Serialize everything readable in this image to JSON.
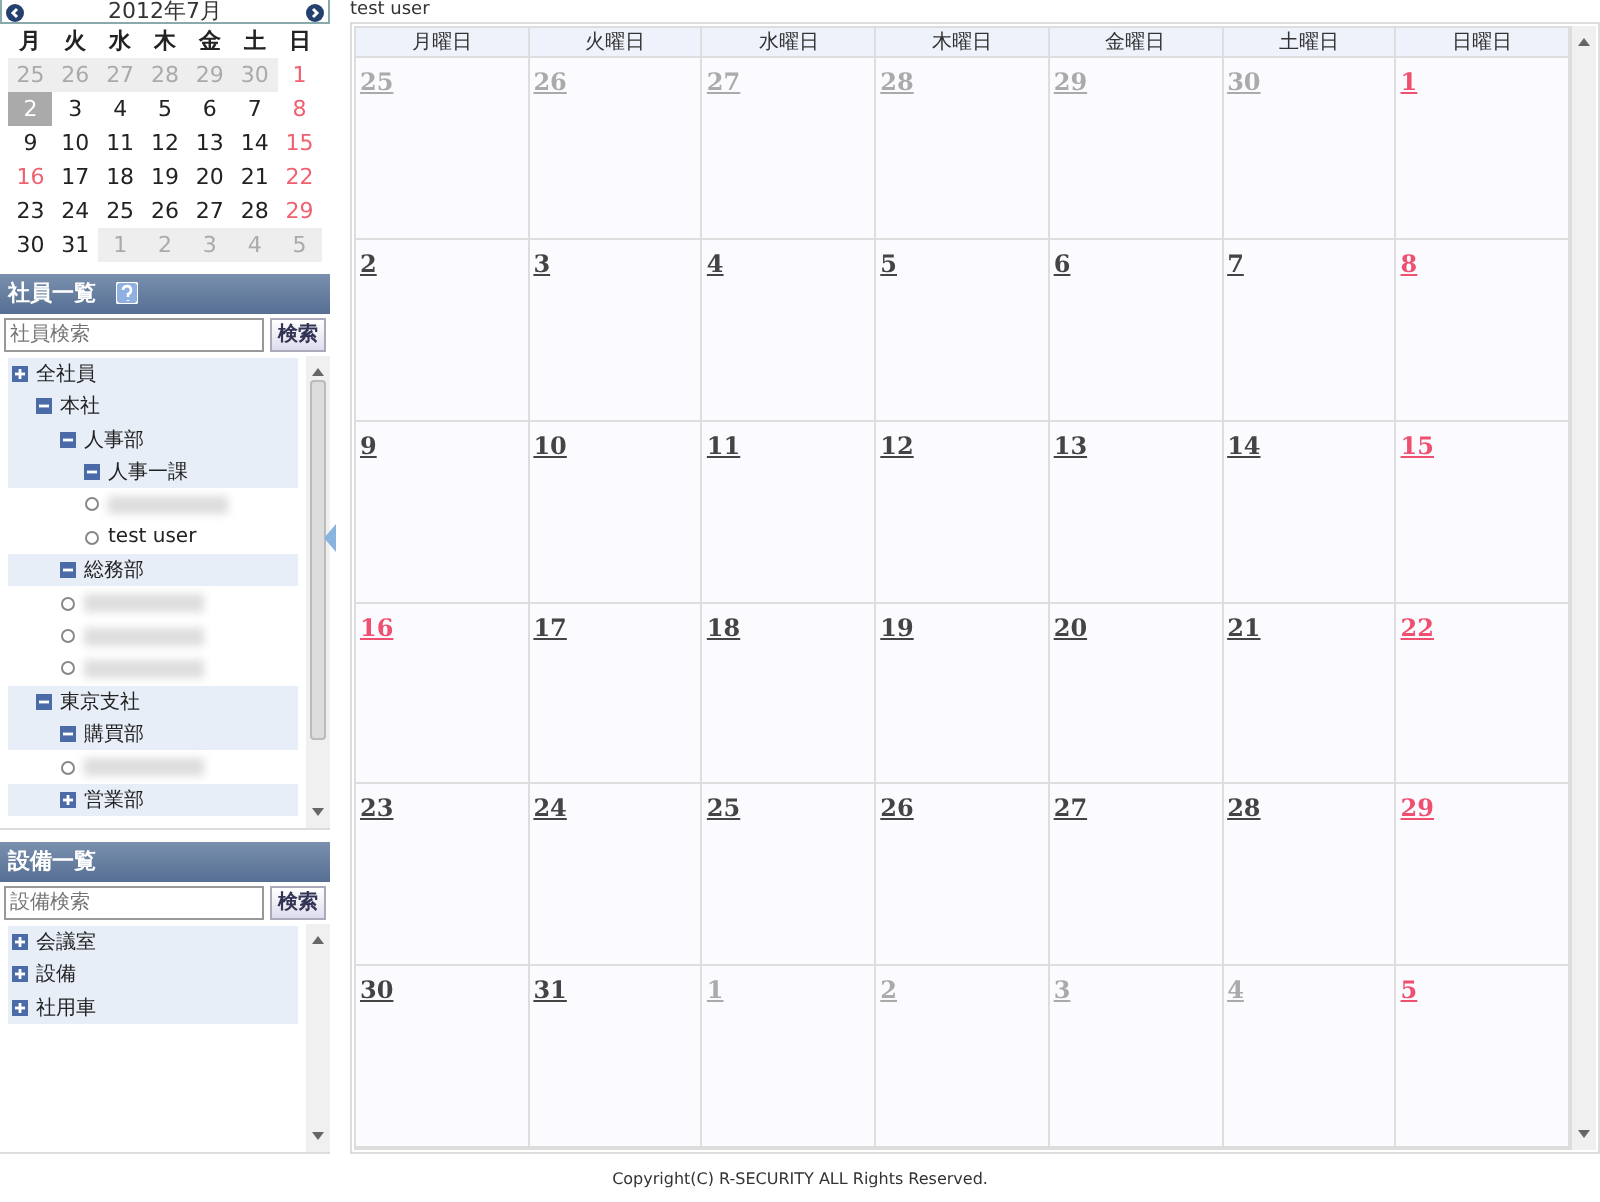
{
  "mini_calendar": {
    "title": "2012年7月",
    "weekdays": [
      "月",
      "火",
      "水",
      "木",
      "金",
      "土",
      "日"
    ],
    "weeks": [
      [
        {
          "day": "25",
          "kind": "other",
          "selected": false
        },
        {
          "day": "26",
          "kind": "other",
          "selected": false
        },
        {
          "day": "27",
          "kind": "other",
          "selected": false
        },
        {
          "day": "28",
          "kind": "other",
          "selected": false
        },
        {
          "day": "29",
          "kind": "other",
          "selected": false
        },
        {
          "day": "30",
          "kind": "other",
          "selected": false
        },
        {
          "day": "1",
          "kind": "holiday",
          "selected": false
        }
      ],
      [
        {
          "day": "2",
          "kind": "normal",
          "selected": true
        },
        {
          "day": "3",
          "kind": "normal",
          "selected": false
        },
        {
          "day": "4",
          "kind": "normal",
          "selected": false
        },
        {
          "day": "5",
          "kind": "normal",
          "selected": false
        },
        {
          "day": "6",
          "kind": "normal",
          "selected": false
        },
        {
          "day": "7",
          "kind": "normal",
          "selected": false
        },
        {
          "day": "8",
          "kind": "holiday",
          "selected": false
        }
      ],
      [
        {
          "day": "9",
          "kind": "normal",
          "selected": false
        },
        {
          "day": "10",
          "kind": "normal",
          "selected": false
        },
        {
          "day": "11",
          "kind": "normal",
          "selected": false
        },
        {
          "day": "12",
          "kind": "normal",
          "selected": false
        },
        {
          "day": "13",
          "kind": "normal",
          "selected": false
        },
        {
          "day": "14",
          "kind": "normal",
          "selected": false
        },
        {
          "day": "15",
          "kind": "holiday",
          "selected": false
        }
      ],
      [
        {
          "day": "16",
          "kind": "holiday",
          "selected": false
        },
        {
          "day": "17",
          "kind": "normal",
          "selected": false
        },
        {
          "day": "18",
          "kind": "normal",
          "selected": false
        },
        {
          "day": "19",
          "kind": "normal",
          "selected": false
        },
        {
          "day": "20",
          "kind": "normal",
          "selected": false
        },
        {
          "day": "21",
          "kind": "normal",
          "selected": false
        },
        {
          "day": "22",
          "kind": "holiday",
          "selected": false
        }
      ],
      [
        {
          "day": "23",
          "kind": "normal",
          "selected": false
        },
        {
          "day": "24",
          "kind": "normal",
          "selected": false
        },
        {
          "day": "25",
          "kind": "normal",
          "selected": false
        },
        {
          "day": "26",
          "kind": "normal",
          "selected": false
        },
        {
          "day": "27",
          "kind": "normal",
          "selected": false
        },
        {
          "day": "28",
          "kind": "normal",
          "selected": false
        },
        {
          "day": "29",
          "kind": "holiday",
          "selected": false
        }
      ],
      [
        {
          "day": "30",
          "kind": "normal",
          "selected": false
        },
        {
          "day": "31",
          "kind": "normal",
          "selected": false
        },
        {
          "day": "1",
          "kind": "other",
          "selected": false
        },
        {
          "day": "2",
          "kind": "other",
          "selected": false
        },
        {
          "day": "3",
          "kind": "other",
          "selected": false
        },
        {
          "day": "4",
          "kind": "other",
          "selected": false
        },
        {
          "day": "5",
          "kind": "other",
          "selected": false
        }
      ]
    ]
  },
  "employee_panel": {
    "title": "社員一覧",
    "search": {
      "placeholder": "社員検索",
      "button": "検索"
    },
    "tree": [
      {
        "kind": "group",
        "label": "全社員",
        "expanded": false,
        "children": [
          {
            "kind": "group",
            "label": "本社",
            "expanded": true,
            "children": [
              {
                "kind": "group",
                "label": "人事部",
                "expanded": true,
                "children": [
                  {
                    "kind": "group",
                    "label": "人事一課",
                    "expanded": true
                  },
                  {
                    "kind": "hidden"
                  },
                  {
                    "kind": "person",
                    "label": "test user"
                  }
                ]
              },
              {
                "kind": "group",
                "label": "総務部",
                "expanded": true
              },
              {
                "kind": "hidden"
              },
              {
                "kind": "hidden"
              },
              {
                "kind": "hidden"
              }
            ]
          },
          {
            "kind": "group",
            "label": "東京支社",
            "expanded": true,
            "children": [
              {
                "kind": "group",
                "label": "購買部",
                "expanded": true
              },
              {
                "kind": "hidden"
              },
              {
                "kind": "group",
                "label": "営業部",
                "expanded": false
              }
            ]
          }
        ]
      }
    ]
  },
  "facility_panel": {
    "title": "設備一覧",
    "search": {
      "placeholder": "設備検索",
      "button": "検索"
    },
    "tree": [
      {
        "kind": "group",
        "label": "会議室",
        "expanded": false
      },
      {
        "kind": "group",
        "label": "設備",
        "expanded": false
      },
      {
        "kind": "group",
        "label": "社用車",
        "expanded": false
      }
    ]
  },
  "calendar": {
    "user": "test user",
    "weekdays": [
      "月曜日",
      "火曜日",
      "水曜日",
      "木曜日",
      "金曜日",
      "土曜日",
      "日曜日"
    ],
    "weeks": [
      [
        {
          "day": "25",
          "kind": "other"
        },
        {
          "day": "26",
          "kind": "other"
        },
        {
          "day": "27",
          "kind": "other"
        },
        {
          "day": "28",
          "kind": "other"
        },
        {
          "day": "29",
          "kind": "other"
        },
        {
          "day": "30",
          "kind": "other"
        },
        {
          "day": "1",
          "kind": "holiday"
        }
      ],
      [
        {
          "day": "2",
          "kind": "normal"
        },
        {
          "day": "3",
          "kind": "normal"
        },
        {
          "day": "4",
          "kind": "normal"
        },
        {
          "day": "5",
          "kind": "normal"
        },
        {
          "day": "6",
          "kind": "normal"
        },
        {
          "day": "7",
          "kind": "normal"
        },
        {
          "day": "8",
          "kind": "holiday"
        }
      ],
      [
        {
          "day": "9",
          "kind": "normal"
        },
        {
          "day": "10",
          "kind": "normal"
        },
        {
          "day": "11",
          "kind": "normal"
        },
        {
          "day": "12",
          "kind": "normal"
        },
        {
          "day": "13",
          "kind": "normal"
        },
        {
          "day": "14",
          "kind": "normal"
        },
        {
          "day": "15",
          "kind": "holiday"
        }
      ],
      [
        {
          "day": "16",
          "kind": "holiday"
        },
        {
          "day": "17",
          "kind": "normal"
        },
        {
          "day": "18",
          "kind": "normal"
        },
        {
          "day": "19",
          "kind": "normal"
        },
        {
          "day": "20",
          "kind": "normal"
        },
        {
          "day": "21",
          "kind": "normal"
        },
        {
          "day": "22",
          "kind": "holiday"
        }
      ],
      [
        {
          "day": "23",
          "kind": "normal"
        },
        {
          "day": "24",
          "kind": "normal"
        },
        {
          "day": "25",
          "kind": "normal"
        },
        {
          "day": "26",
          "kind": "normal"
        },
        {
          "day": "27",
          "kind": "normal"
        },
        {
          "day": "28",
          "kind": "normal"
        },
        {
          "day": "29",
          "kind": "holiday"
        }
      ],
      [
        {
          "day": "30",
          "kind": "normal"
        },
        {
          "day": "31",
          "kind": "normal"
        },
        {
          "day": "1",
          "kind": "other"
        },
        {
          "day": "2",
          "kind": "other"
        },
        {
          "day": "3",
          "kind": "other"
        },
        {
          "day": "4",
          "kind": "other"
        },
        {
          "day": "5",
          "kind": "holiday"
        }
      ]
    ]
  },
  "footer": "Copyright(C) R-SECURITY ALL Rights Reserved."
}
